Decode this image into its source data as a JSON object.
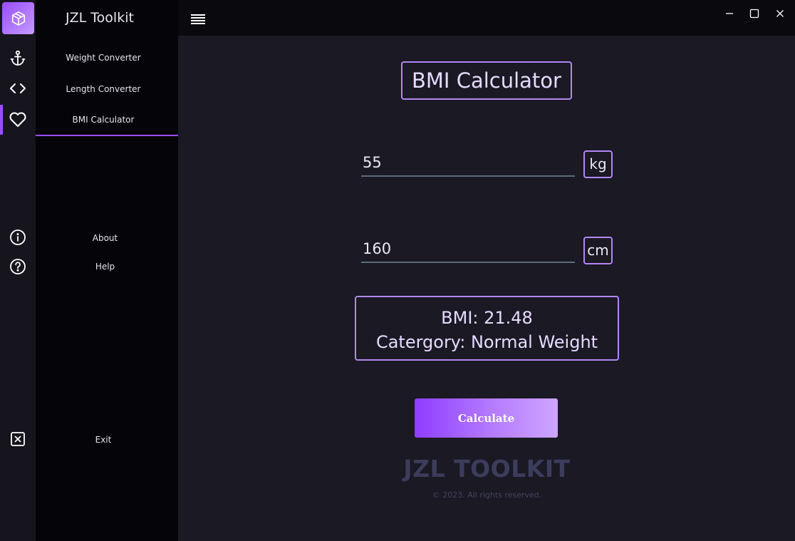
{
  "app": {
    "title": "JZL Toolkit",
    "accent_color": "#9a4dff",
    "logo_icon": "cube-icon"
  },
  "rail": {
    "icons": [
      "anchor-icon",
      "code-icon",
      "heart-icon",
      "info-icon",
      "help-icon",
      "exit-icon"
    ],
    "active": "heart-icon"
  },
  "sidebar": {
    "items": [
      {
        "label": "Weight Converter"
      },
      {
        "label": "Length Converter"
      },
      {
        "label": "BMI Calculator",
        "active": true
      },
      {
        "label": "About"
      },
      {
        "label": "Help"
      },
      {
        "label": "Exit"
      }
    ]
  },
  "window_controls": [
    "minimize-icon",
    "maximize-icon",
    "close-icon"
  ],
  "main": {
    "title": "BMI Calculator",
    "weight": {
      "value": "55",
      "unit": "kg"
    },
    "height": {
      "value": "160",
      "unit": "cm"
    },
    "result": {
      "bmi_line": "BMI: 21.48",
      "category_line": "Catergory: Normal Weight"
    },
    "calculate_label": "Calculate",
    "brand": "JZL TOOLKIT",
    "copyright": "© 2023. All rights reserved."
  }
}
